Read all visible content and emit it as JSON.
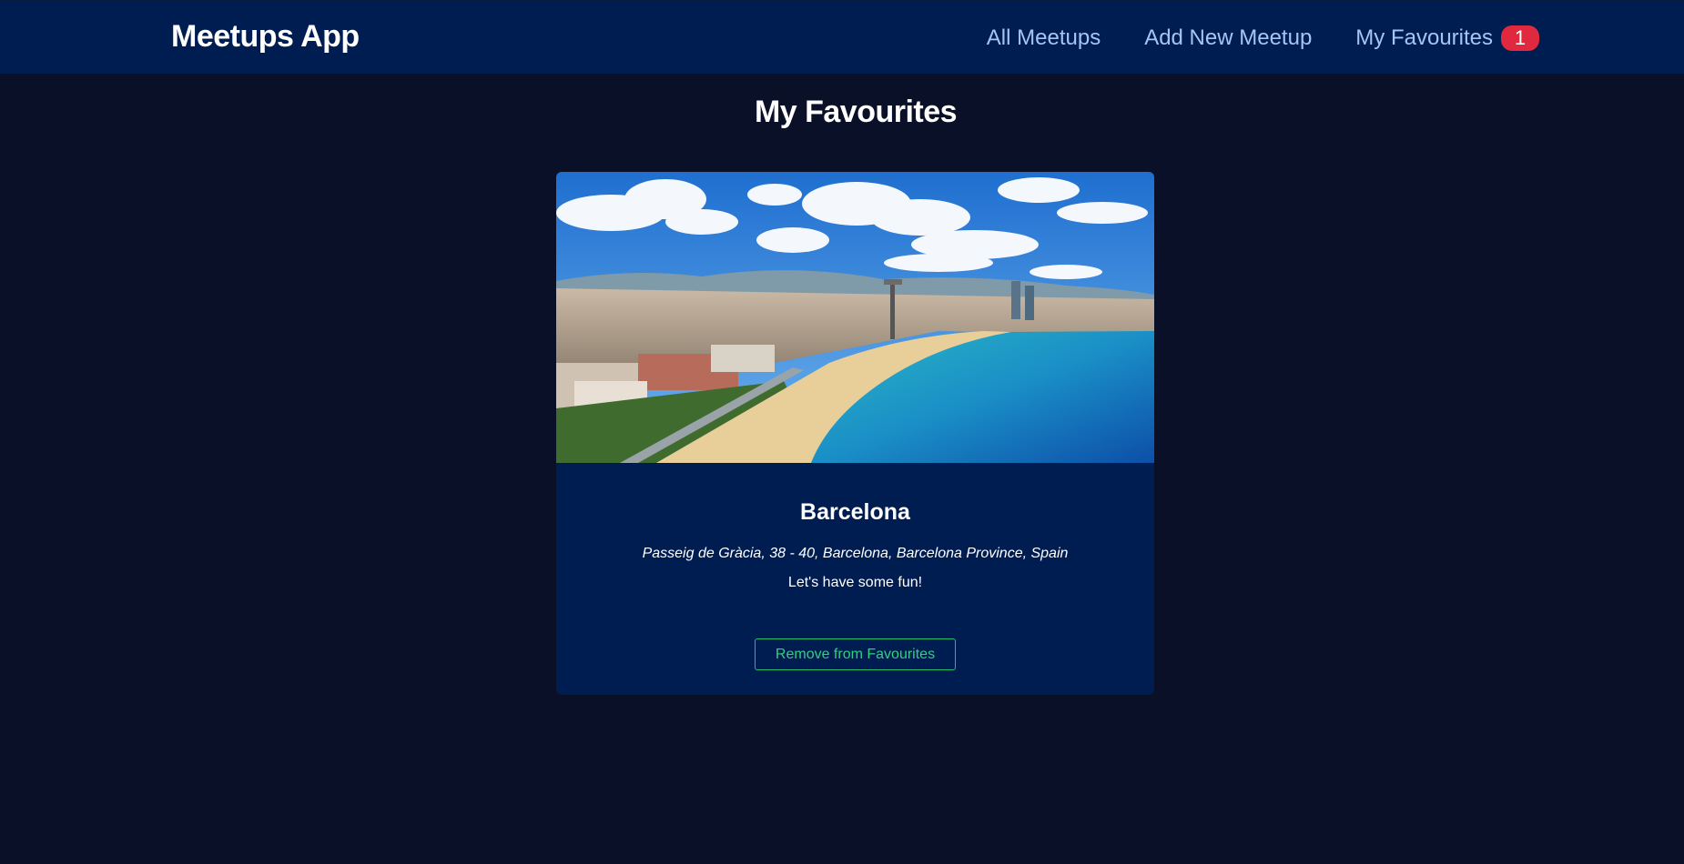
{
  "header": {
    "logo": "Meetups App",
    "nav": {
      "all_meetups": "All Meetups",
      "add_new_meetup": "Add New Meetup",
      "my_favourites": "My Favourites",
      "favourites_count": "1"
    }
  },
  "main": {
    "title": "My Favourites",
    "meetups": [
      {
        "title": "Barcelona",
        "address": "Passeig de Gràcia, 38 - 40, Barcelona, Barcelona Province, Spain",
        "description": "Let's have some fun!",
        "button_label": "Remove from Favourites"
      }
    ]
  },
  "colors": {
    "background": "#0a1028",
    "header": "#001d52",
    "card": "#001d52",
    "nav_link": "#a6c5f2",
    "badge": "#e0283f",
    "button_accent": "#2fd07e"
  }
}
